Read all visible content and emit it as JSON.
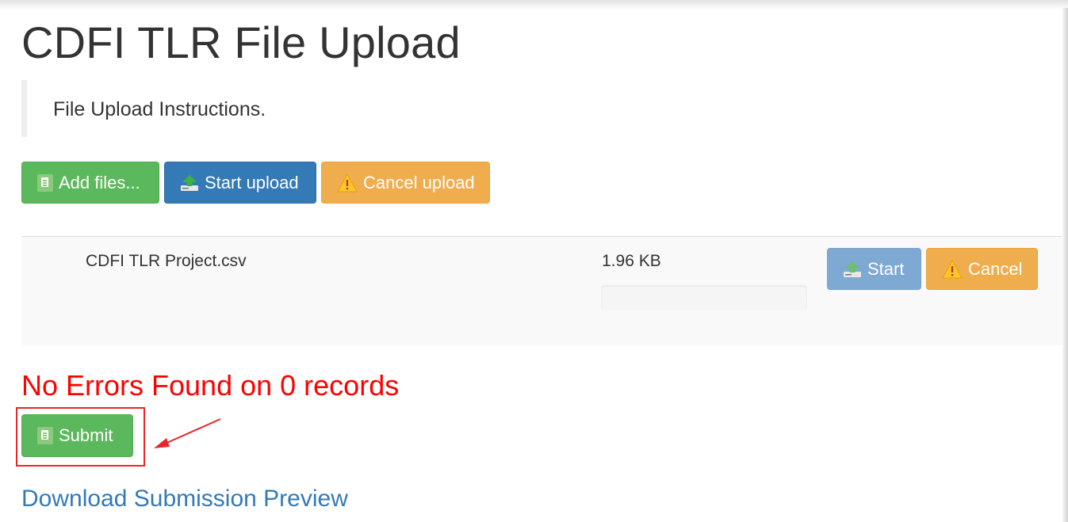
{
  "page": {
    "title": "CDFI TLR File Upload",
    "instructions": "File Upload Instructions."
  },
  "toolbar": {
    "add_files_label": "Add files...",
    "start_upload_label": "Start upload",
    "cancel_upload_label": "Cancel upload"
  },
  "file": {
    "name": "CDFI TLR Project.csv",
    "size": "1.96 KB",
    "progress_fraction": 0,
    "start_label": "Start",
    "cancel_label": "Cancel"
  },
  "result": {
    "message": "No Errors Found on 0 records",
    "submit_label": "Submit",
    "download_label": "Download Submission Preview"
  },
  "colors": {
    "success": "#5cb85c",
    "primary": "#337ab7",
    "warning": "#f0ad4e",
    "error_text": "#ff0000",
    "annotation": "#e8262a",
    "link": "#337ab7"
  },
  "icons": {
    "add_files": "file-icon",
    "start_upload": "upload-icon",
    "cancel_upload": "warning-icon",
    "submit": "file-icon"
  }
}
